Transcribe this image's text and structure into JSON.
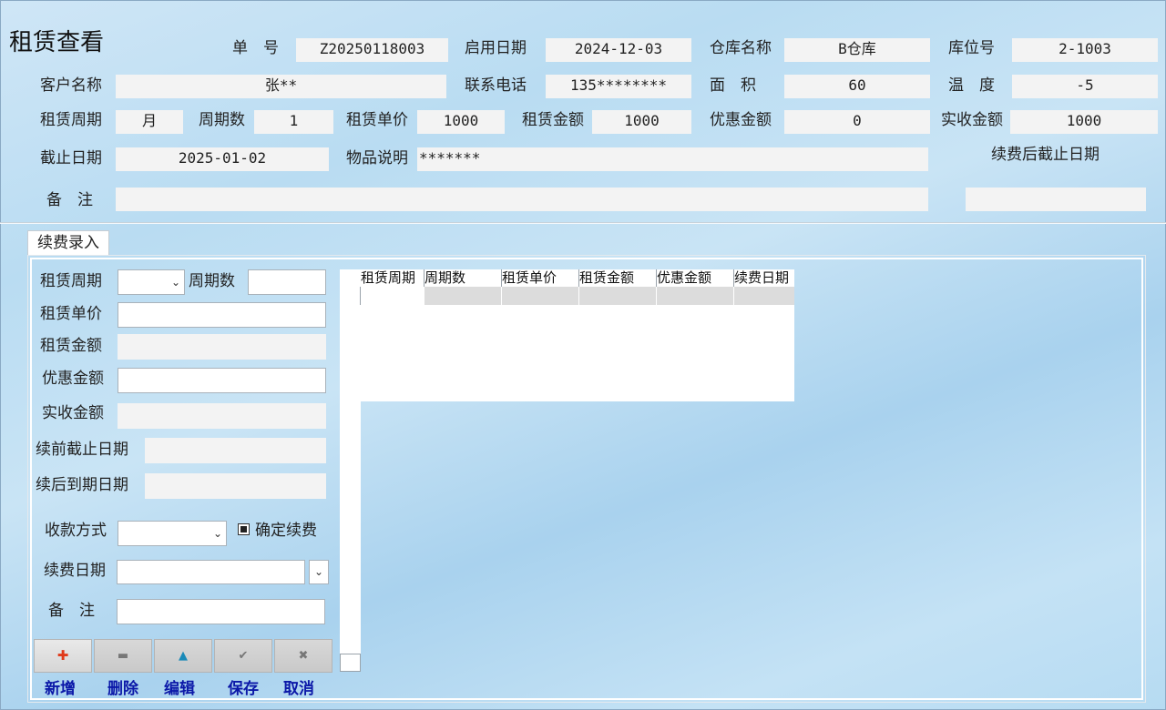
{
  "page": {
    "title": "租赁查看"
  },
  "header": {
    "order_no": {
      "label": "单　号",
      "value": "Z20250118003"
    },
    "start_date": {
      "label": "启用日期",
      "value": "2024-12-03"
    },
    "warehouse": {
      "label": "仓库名称",
      "value": "B仓库"
    },
    "location": {
      "label": "库位号",
      "value": "2-1003"
    },
    "customer": {
      "label": "客户名称",
      "value": "张**"
    },
    "phone": {
      "label": "联系电话",
      "value": "135********"
    },
    "area": {
      "label": "面　积",
      "value": "60"
    },
    "temperature": {
      "label": "温　度",
      "value": "-5"
    },
    "period": {
      "label": "租赁周期",
      "value": "月"
    },
    "period_count": {
      "label": "周期数",
      "value": "1"
    },
    "unit_price": {
      "label": "租赁单价",
      "value": "1000"
    },
    "amount": {
      "label": "租赁金额",
      "value": "1000"
    },
    "discount": {
      "label": "优惠金额",
      "value": "0"
    },
    "received": {
      "label": "实收金额",
      "value": "1000"
    },
    "end_date": {
      "label": "截止日期",
      "value": "2025-01-02"
    },
    "item_desc": {
      "label": "物品说明",
      "value": "*******"
    },
    "renew_end_date": {
      "label": "续费后截止日期",
      "value": ""
    },
    "remark": {
      "label": "备　注",
      "value": ""
    }
  },
  "renewal": {
    "tab_label": "续费录入",
    "form": {
      "period_label": "租赁周期",
      "period_count_label": "周期数",
      "unit_price_label": "租赁单价",
      "amount_label": "租赁金额",
      "discount_label": "优惠金额",
      "received_label": "实收金额",
      "before_end_label": "续前截止日期",
      "after_end_label": "续后到期日期",
      "payment_label": "收款方式",
      "confirm_label": "确定续费",
      "renew_date_label": "续费日期",
      "remark_label": "备　注"
    },
    "grid": {
      "columns": [
        "租赁周期",
        "周期数",
        "租赁单价",
        "租赁金额",
        "优惠金额",
        "续费日期"
      ]
    },
    "toolbar": {
      "add": {
        "label": "新增",
        "icon": "plus-icon",
        "color": "#e03a1a"
      },
      "delete": {
        "label": "删除",
        "icon": "minus-icon",
        "color": "#777777"
      },
      "edit": {
        "label": "编辑",
        "icon": "triangle-up-icon",
        "color": "#1a8ab8"
      },
      "save": {
        "label": "保存",
        "icon": "check-icon",
        "color": "#777777"
      },
      "cancel": {
        "label": "取消",
        "icon": "close-icon",
        "color": "#777777"
      }
    }
  },
  "colors": {
    "button_text": "#0b18a8",
    "field_bg": "#f3f3f3"
  }
}
